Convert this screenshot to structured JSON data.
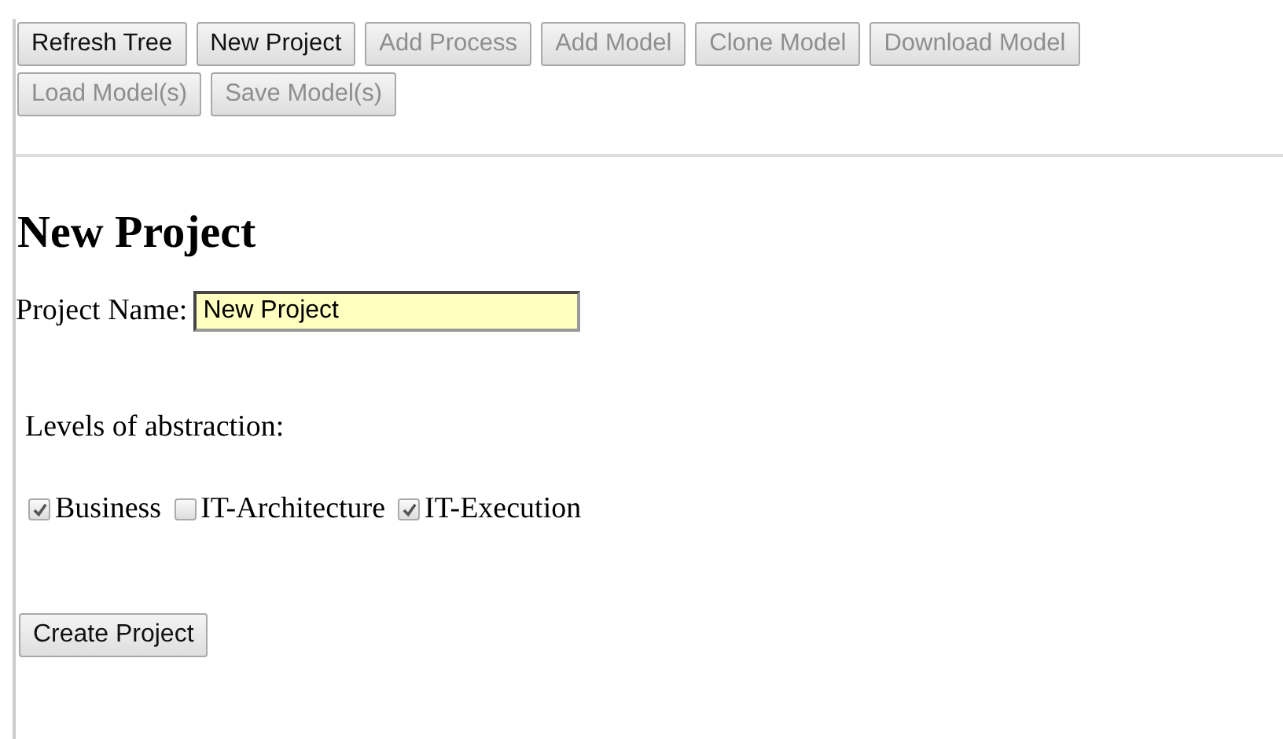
{
  "toolbar": [
    {
      "label": "Refresh Tree",
      "disabled": false
    },
    {
      "label": "New Project",
      "disabled": false
    },
    {
      "label": "Add Process",
      "disabled": true
    },
    {
      "label": "Add Model",
      "disabled": true
    },
    {
      "label": "Clone Model",
      "disabled": true
    },
    {
      "label": "Download Model",
      "disabled": true
    },
    {
      "label": "Load Model(s)",
      "disabled": true
    },
    {
      "label": "Save Model(s)",
      "disabled": true
    }
  ],
  "heading": "New Project",
  "project_name": {
    "label": "Project Name:",
    "value": "New Project"
  },
  "levels_label": "Levels of abstraction:",
  "levels": [
    {
      "label": "Business",
      "checked": true
    },
    {
      "label": "IT-Architecture",
      "checked": false
    },
    {
      "label": "IT-Execution",
      "checked": true
    }
  ],
  "submit": "Create Project"
}
